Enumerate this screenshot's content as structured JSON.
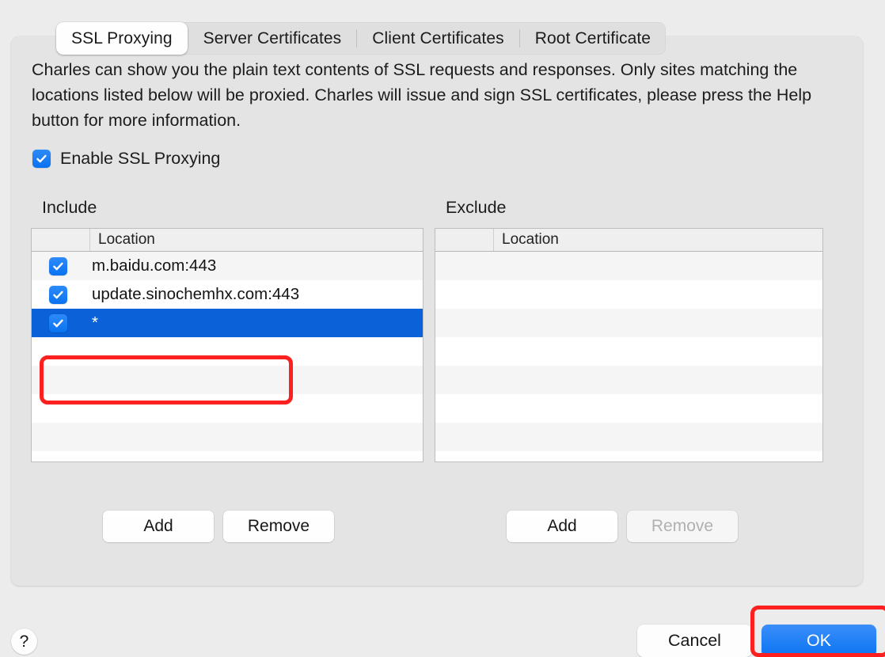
{
  "tabs": [
    {
      "label": "SSL Proxying",
      "active": true
    },
    {
      "label": "Server Certificates",
      "active": false
    },
    {
      "label": "Client Certificates",
      "active": false
    },
    {
      "label": "Root Certificate",
      "active": false
    }
  ],
  "description": "Charles can show you the plain text contents of SSL requests and responses. Only sites matching the locations listed below will be proxied. Charles will issue and sign SSL certificates, please press the Help button for more information.",
  "enable_ssl": {
    "label": "Enable SSL Proxying",
    "checked": true
  },
  "include": {
    "caption": "Include",
    "column_header": "Location",
    "rows": [
      {
        "location": "m.baidu.com:443",
        "checked": true,
        "selected": false
      },
      {
        "location": "update.sinochemhx.com:443",
        "checked": true,
        "selected": false
      },
      {
        "location": "*",
        "checked": true,
        "selected": true
      }
    ],
    "empty_rows": 4,
    "add_label": "Add",
    "remove_label": "Remove",
    "remove_disabled": false
  },
  "exclude": {
    "caption": "Exclude",
    "column_header": "Location",
    "rows": [],
    "empty_rows": 7,
    "add_label": "Add",
    "remove_label": "Remove",
    "remove_disabled": true
  },
  "footer": {
    "help_label": "?",
    "cancel_label": "Cancel",
    "ok_label": "OK"
  },
  "colors": {
    "accent_blue": "#0a74f2",
    "selection_blue": "#0a61d8",
    "annotation_red": "#fc2020",
    "window_background": "#ececec",
    "panel_background": "#e4e4e4"
  }
}
